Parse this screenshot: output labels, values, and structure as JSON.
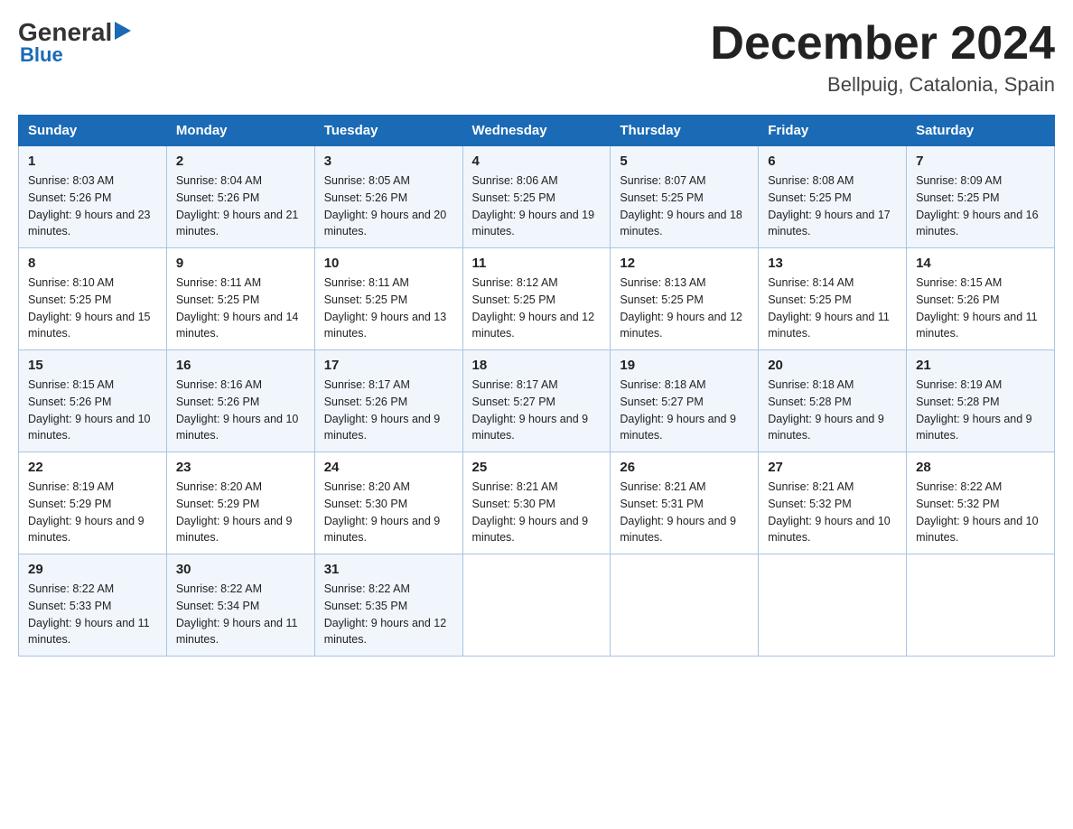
{
  "logo": {
    "general": "General",
    "arrow": "▶",
    "blue": "Blue"
  },
  "title": {
    "month_year": "December 2024",
    "location": "Bellpuig, Catalonia, Spain"
  },
  "days_of_week": [
    "Sunday",
    "Monday",
    "Tuesday",
    "Wednesday",
    "Thursday",
    "Friday",
    "Saturday"
  ],
  "weeks": [
    [
      {
        "day": "1",
        "sunrise": "8:03 AM",
        "sunset": "5:26 PM",
        "daylight": "9 hours and 23 minutes."
      },
      {
        "day": "2",
        "sunrise": "8:04 AM",
        "sunset": "5:26 PM",
        "daylight": "9 hours and 21 minutes."
      },
      {
        "day": "3",
        "sunrise": "8:05 AM",
        "sunset": "5:26 PM",
        "daylight": "9 hours and 20 minutes."
      },
      {
        "day": "4",
        "sunrise": "8:06 AM",
        "sunset": "5:25 PM",
        "daylight": "9 hours and 19 minutes."
      },
      {
        "day": "5",
        "sunrise": "8:07 AM",
        "sunset": "5:25 PM",
        "daylight": "9 hours and 18 minutes."
      },
      {
        "day": "6",
        "sunrise": "8:08 AM",
        "sunset": "5:25 PM",
        "daylight": "9 hours and 17 minutes."
      },
      {
        "day": "7",
        "sunrise": "8:09 AM",
        "sunset": "5:25 PM",
        "daylight": "9 hours and 16 minutes."
      }
    ],
    [
      {
        "day": "8",
        "sunrise": "8:10 AM",
        "sunset": "5:25 PM",
        "daylight": "9 hours and 15 minutes."
      },
      {
        "day": "9",
        "sunrise": "8:11 AM",
        "sunset": "5:25 PM",
        "daylight": "9 hours and 14 minutes."
      },
      {
        "day": "10",
        "sunrise": "8:11 AM",
        "sunset": "5:25 PM",
        "daylight": "9 hours and 13 minutes."
      },
      {
        "day": "11",
        "sunrise": "8:12 AM",
        "sunset": "5:25 PM",
        "daylight": "9 hours and 12 minutes."
      },
      {
        "day": "12",
        "sunrise": "8:13 AM",
        "sunset": "5:25 PM",
        "daylight": "9 hours and 12 minutes."
      },
      {
        "day": "13",
        "sunrise": "8:14 AM",
        "sunset": "5:25 PM",
        "daylight": "9 hours and 11 minutes."
      },
      {
        "day": "14",
        "sunrise": "8:15 AM",
        "sunset": "5:26 PM",
        "daylight": "9 hours and 11 minutes."
      }
    ],
    [
      {
        "day": "15",
        "sunrise": "8:15 AM",
        "sunset": "5:26 PM",
        "daylight": "9 hours and 10 minutes."
      },
      {
        "day": "16",
        "sunrise": "8:16 AM",
        "sunset": "5:26 PM",
        "daylight": "9 hours and 10 minutes."
      },
      {
        "day": "17",
        "sunrise": "8:17 AM",
        "sunset": "5:26 PM",
        "daylight": "9 hours and 9 minutes."
      },
      {
        "day": "18",
        "sunrise": "8:17 AM",
        "sunset": "5:27 PM",
        "daylight": "9 hours and 9 minutes."
      },
      {
        "day": "19",
        "sunrise": "8:18 AM",
        "sunset": "5:27 PM",
        "daylight": "9 hours and 9 minutes."
      },
      {
        "day": "20",
        "sunrise": "8:18 AM",
        "sunset": "5:28 PM",
        "daylight": "9 hours and 9 minutes."
      },
      {
        "day": "21",
        "sunrise": "8:19 AM",
        "sunset": "5:28 PM",
        "daylight": "9 hours and 9 minutes."
      }
    ],
    [
      {
        "day": "22",
        "sunrise": "8:19 AM",
        "sunset": "5:29 PM",
        "daylight": "9 hours and 9 minutes."
      },
      {
        "day": "23",
        "sunrise": "8:20 AM",
        "sunset": "5:29 PM",
        "daylight": "9 hours and 9 minutes."
      },
      {
        "day": "24",
        "sunrise": "8:20 AM",
        "sunset": "5:30 PM",
        "daylight": "9 hours and 9 minutes."
      },
      {
        "day": "25",
        "sunrise": "8:21 AM",
        "sunset": "5:30 PM",
        "daylight": "9 hours and 9 minutes."
      },
      {
        "day": "26",
        "sunrise": "8:21 AM",
        "sunset": "5:31 PM",
        "daylight": "9 hours and 9 minutes."
      },
      {
        "day": "27",
        "sunrise": "8:21 AM",
        "sunset": "5:32 PM",
        "daylight": "9 hours and 10 minutes."
      },
      {
        "day": "28",
        "sunrise": "8:22 AM",
        "sunset": "5:32 PM",
        "daylight": "9 hours and 10 minutes."
      }
    ],
    [
      {
        "day": "29",
        "sunrise": "8:22 AM",
        "sunset": "5:33 PM",
        "daylight": "9 hours and 11 minutes."
      },
      {
        "day": "30",
        "sunrise": "8:22 AM",
        "sunset": "5:34 PM",
        "daylight": "9 hours and 11 minutes."
      },
      {
        "day": "31",
        "sunrise": "8:22 AM",
        "sunset": "5:35 PM",
        "daylight": "9 hours and 12 minutes."
      },
      null,
      null,
      null,
      null
    ]
  ],
  "labels": {
    "sunrise_prefix": "Sunrise: ",
    "sunset_prefix": "Sunset: ",
    "daylight_prefix": "Daylight: "
  }
}
